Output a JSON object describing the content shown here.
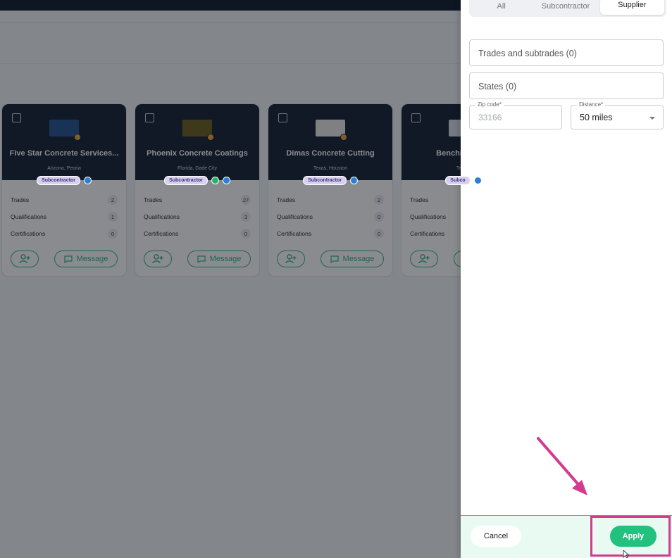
{
  "cards": [
    {
      "name": "Five Star Concrete Services...",
      "location": "Arizona, Peoria",
      "role": "Subcontractor",
      "stats": [
        {
          "label": "Trades",
          "count": "2"
        },
        {
          "label": "Qualifications",
          "count": "1"
        },
        {
          "label": "Certifications",
          "count": "0"
        }
      ],
      "message_label": "Message",
      "logo_color": "#1f4f8f",
      "green_badge": false
    },
    {
      "name": "Phoenix Concrete Coatings",
      "location": "Florida, Dade City",
      "role": "Subcontractor",
      "stats": [
        {
          "label": "Trades",
          "count": "27"
        },
        {
          "label": "Qualifications",
          "count": "3"
        },
        {
          "label": "Certifications",
          "count": "0"
        }
      ],
      "message_label": "Message",
      "logo_color": "#6b5a18",
      "green_badge": true
    },
    {
      "name": "Dimas Concrete Cutting",
      "location": "Texas, Houston",
      "role": "Subcontractor",
      "stats": [
        {
          "label": "Trades",
          "count": "2"
        },
        {
          "label": "Qualifications",
          "count": "0"
        },
        {
          "label": "Certifications",
          "count": "0"
        }
      ],
      "message_label": "Message",
      "logo_color": "#e9e9e9",
      "green_badge": false
    },
    {
      "name": "Benchmark Co",
      "location": "Texas,",
      "role": "Subco",
      "stats": [
        {
          "label": "Trades",
          "count": ""
        },
        {
          "label": "Qualifications",
          "count": ""
        },
        {
          "label": "Certifications",
          "count": ""
        }
      ],
      "message_label": "",
      "logo_color": "#d9dde3",
      "green_badge": false
    }
  ],
  "filter": {
    "segments": [
      "All",
      "Subcontractor",
      "Supplier"
    ],
    "active_segment": "Supplier",
    "trades_placeholder": "Trades and subtrades (0)",
    "states_placeholder": "States (0)",
    "zip_label": "Zip code",
    "zip_value": "33166",
    "distance_label": "Distance",
    "distance_value": "50 miles",
    "required_mark": "*",
    "cancel_label": "Cancel",
    "apply_label": "Apply"
  },
  "colors": {
    "accent_green": "#22c17d",
    "highlight_pink": "#d43a8e",
    "header_navy": "#0e1a2c"
  }
}
